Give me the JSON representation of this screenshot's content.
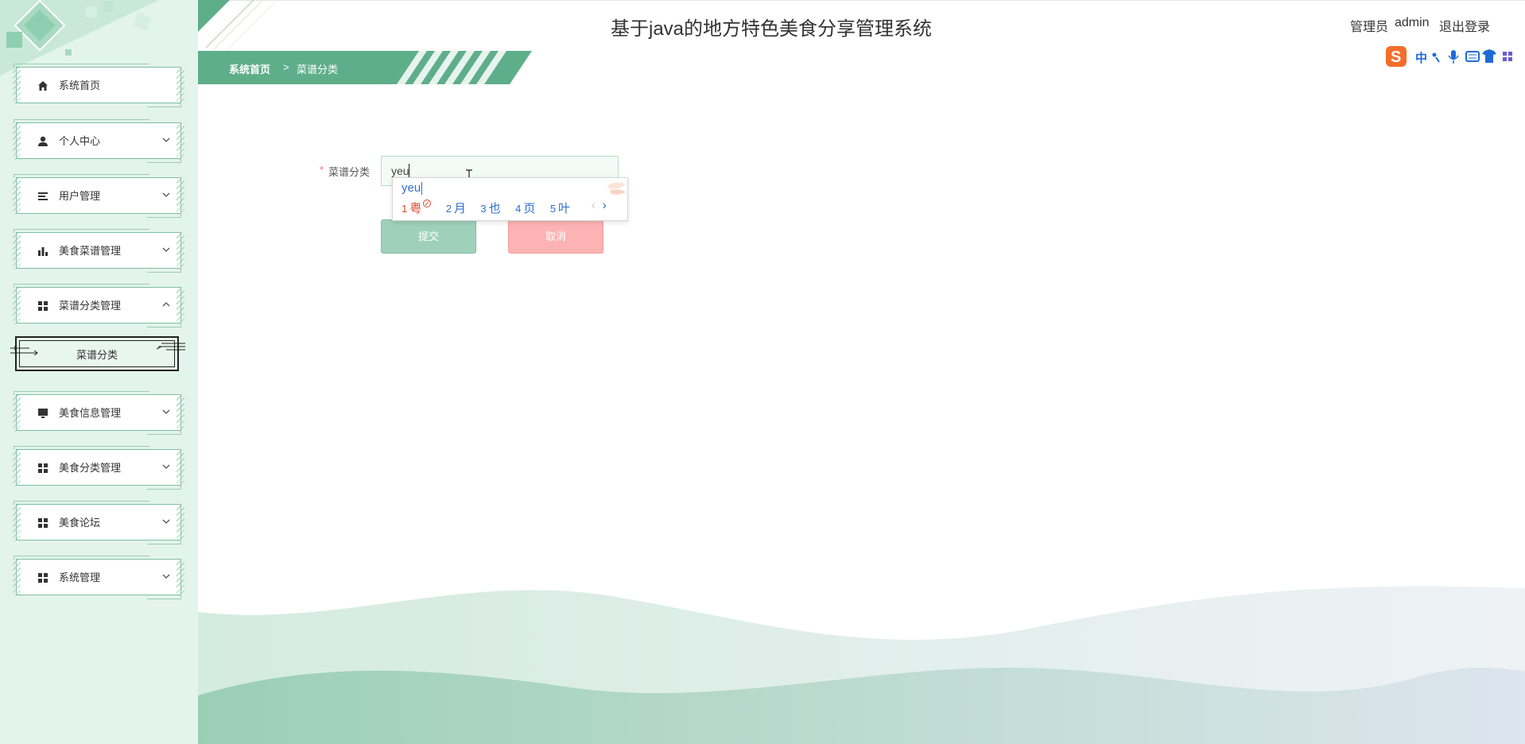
{
  "header": {
    "title": "基于java的地方特色美食分享管理系统",
    "user_role": "管理员",
    "user_name": "admin",
    "logout": "退出登录"
  },
  "breadcrumb": {
    "home": "系统首页",
    "separator": ">",
    "current": "菜谱分类"
  },
  "sidebar": {
    "items": [
      {
        "label": "系统首页",
        "icon": "home-icon",
        "has_chevron": false
      },
      {
        "label": "个人中心",
        "icon": "user-icon",
        "has_chevron": true
      },
      {
        "label": "用户管理",
        "icon": "list-icon",
        "has_chevron": true
      },
      {
        "label": "美食菜谱管理",
        "icon": "bar-chart-icon",
        "has_chevron": true
      },
      {
        "label": "菜谱分类管理",
        "icon": "grid-icon",
        "has_chevron": true,
        "expanded": true
      },
      {
        "label": "美食信息管理",
        "icon": "monitor-icon",
        "has_chevron": true
      },
      {
        "label": "美食分类管理",
        "icon": "grid-icon",
        "has_chevron": true
      },
      {
        "label": "美食论坛",
        "icon": "grid-icon",
        "has_chevron": true
      },
      {
        "label": "系统管理",
        "icon": "grid-icon",
        "has_chevron": true
      }
    ],
    "submenu": {
      "label": "菜谱分类"
    }
  },
  "form": {
    "field_label": "菜谱分类",
    "required_mark": "*",
    "field_value": "yeu",
    "submit_label": "提交",
    "cancel_label": "取消"
  },
  "ime": {
    "pinyin": "yeu",
    "candidates": [
      {
        "num": "1",
        "text": "粤"
      },
      {
        "num": "2",
        "text": "月"
      },
      {
        "num": "3",
        "text": "也"
      },
      {
        "num": "4",
        "text": "页"
      },
      {
        "num": "5",
        "text": "叶"
      }
    ],
    "prev": "‹",
    "next": "›",
    "tray_text": "中"
  },
  "colors": {
    "accent": "#5fae8a",
    "sidebar_bg": "#e3f4ec",
    "submit": "#9fd1ba",
    "cancel": "#fdb3b3"
  }
}
